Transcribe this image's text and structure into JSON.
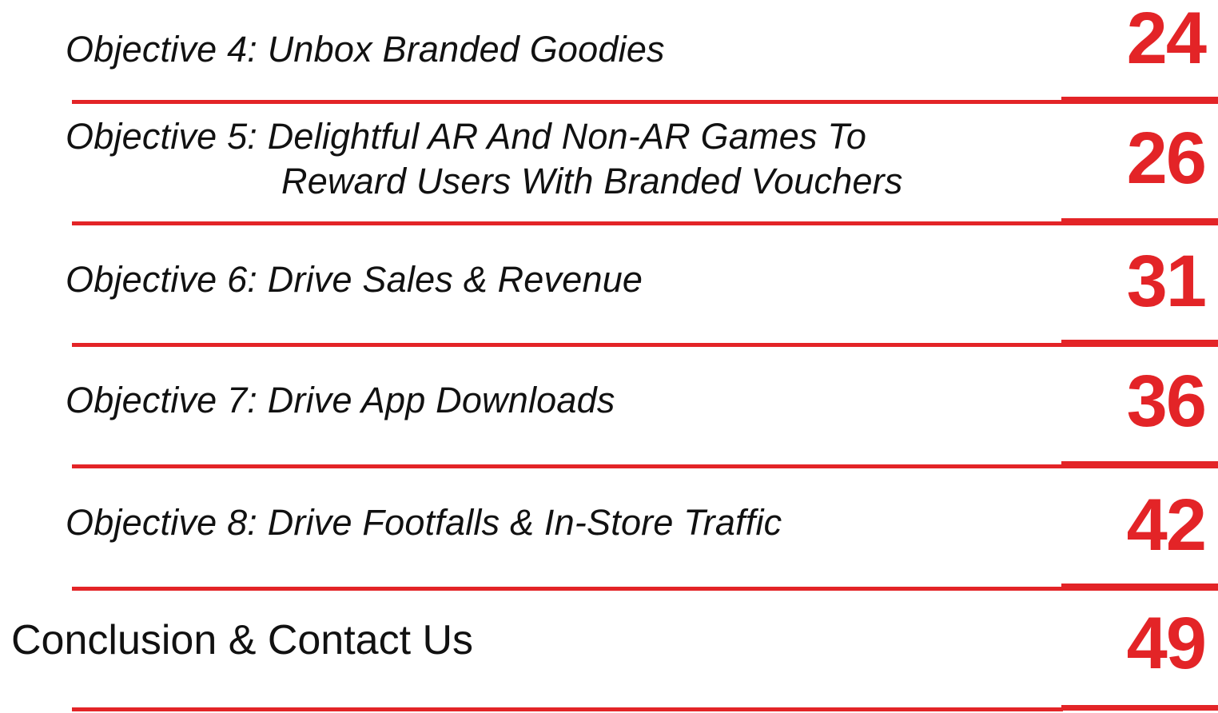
{
  "toc": {
    "entries": [
      {
        "title": "Objective 4: Unbox Branded Goodies",
        "page": "24"
      },
      {
        "title_line1": "Objective 5: Delightful AR And Non-AR Games To",
        "title_line2": "Reward Users With Branded Vouchers",
        "page": "26"
      },
      {
        "title": "Objective 6: Drive Sales & Revenue",
        "page": "31"
      },
      {
        "title": "Objective 7: Drive App Downloads",
        "page": "36"
      },
      {
        "title": "Objective 8: Drive Footfalls & In-Store Traffic",
        "page": "42"
      },
      {
        "title": "Conclusion & Contact Us",
        "page": "49"
      }
    ]
  },
  "colors": {
    "accent": "#e32427",
    "text": "#111111"
  }
}
